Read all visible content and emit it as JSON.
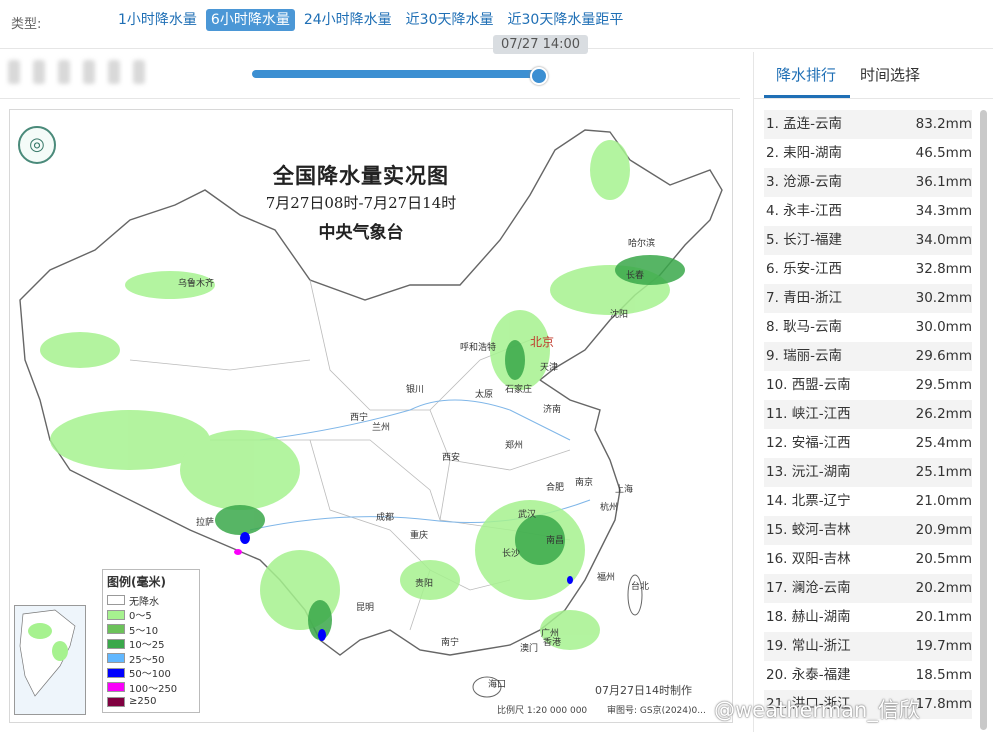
{
  "type_selector": {
    "label": "类型:",
    "tabs": [
      {
        "label": "1小时降水量",
        "active": false
      },
      {
        "label": "6小时降水量",
        "active": true
      },
      {
        "label": "24小时降水量",
        "active": false
      },
      {
        "label": "近30天降水量",
        "active": false
      },
      {
        "label": "近30天降水量距平",
        "active": false
      }
    ]
  },
  "time_slider": {
    "tooltip": "07/27 14:00",
    "position_fraction": 1.0
  },
  "map": {
    "title": "全国降水量实况图",
    "subtitle": "7月27日08时-7月27日14时",
    "agency": "中央气象台",
    "cities": [
      "乌鲁木齐",
      "哈尔滨",
      "长春",
      "沈阳",
      "北京",
      "天津",
      "呼和浩特",
      "石家庄",
      "太原",
      "济南",
      "银川",
      "西宁",
      "兰州",
      "郑州",
      "西安",
      "南京",
      "上海",
      "合肥",
      "杭州",
      "武汉",
      "成都",
      "重庆",
      "拉萨",
      "长沙",
      "南昌",
      "福州",
      "台北",
      "贵阳",
      "昆明",
      "南宁",
      "广州",
      "澳门",
      "香港",
      "海口"
    ],
    "legend": {
      "title": "图例(毫米)",
      "items": [
        {
          "label": "无降水",
          "color": "#ffffff"
        },
        {
          "label": "0～5",
          "color": "#a6f28f"
        },
        {
          "label": "5～10",
          "color": "#6cc25a"
        },
        {
          "label": "10～25",
          "color": "#3aa84a"
        },
        {
          "label": "25～50",
          "color": "#62b8ff"
        },
        {
          "label": "50～100",
          "color": "#0000fe"
        },
        {
          "label": "100～250",
          "color": "#fa00fa"
        },
        {
          "label": "≥250",
          "color": "#800040"
        }
      ]
    },
    "made_time": "07月27日14时制作",
    "scale": "比例尺 1:20 000 000",
    "review_no": "审图号: GS京(2024)0..."
  },
  "panel": {
    "tabs": [
      {
        "label": "降水排行",
        "active": true
      },
      {
        "label": "时间选择",
        "active": false
      }
    ],
    "ranking": [
      {
        "name": "1. 孟连-云南",
        "value": "83.2mm"
      },
      {
        "name": "2. 耒阳-湖南",
        "value": "46.5mm"
      },
      {
        "name": "3. 沧源-云南",
        "value": "36.1mm"
      },
      {
        "name": "4. 永丰-江西",
        "value": "34.3mm"
      },
      {
        "name": "5. 长汀-福建",
        "value": "34.0mm"
      },
      {
        "name": "6. 乐安-江西",
        "value": "32.8mm"
      },
      {
        "name": "7. 青田-浙江",
        "value": "30.2mm"
      },
      {
        "name": "8. 耿马-云南",
        "value": "30.0mm"
      },
      {
        "name": "9. 瑞丽-云南",
        "value": "29.6mm"
      },
      {
        "name": "10. 西盟-云南",
        "value": "29.5mm"
      },
      {
        "name": "11. 峡江-江西",
        "value": "26.2mm"
      },
      {
        "name": "12. 安福-江西",
        "value": "25.4mm"
      },
      {
        "name": "13. 沅江-湖南",
        "value": "25.1mm"
      },
      {
        "name": "14. 北票-辽宁",
        "value": "21.0mm"
      },
      {
        "name": "15. 蛟河-吉林",
        "value": "20.9mm"
      },
      {
        "name": "16. 双阳-吉林",
        "value": "20.5mm"
      },
      {
        "name": "17. 澜沧-云南",
        "value": "20.2mm"
      },
      {
        "name": "18. 赫山-湖南",
        "value": "20.1mm"
      },
      {
        "name": "19. 常山-浙江",
        "value": "19.7mm"
      },
      {
        "name": "20. 永泰-福建",
        "value": "18.5mm"
      },
      {
        "name": "21. 洪口-浙江",
        "value": "17.8mm"
      }
    ]
  },
  "watermark": "@weatherman_信欣"
}
